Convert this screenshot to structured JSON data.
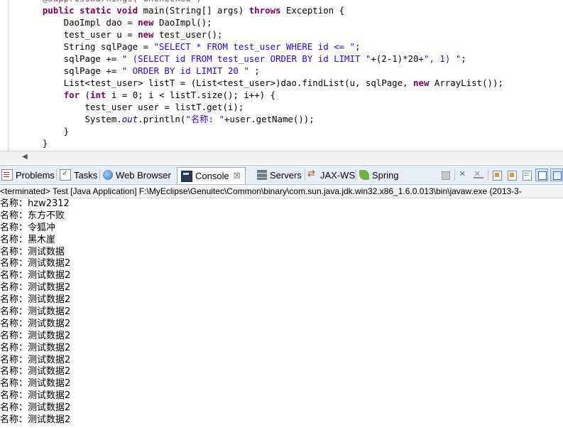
{
  "editor": {
    "lines": [
      [
        {
          "t": "    ",
          "c": ""
        },
        {
          "t": "@SuppressWarnings(\"unchecked\")",
          "c": "ann"
        }
      ],
      [
        {
          "t": "    ",
          "c": ""
        },
        {
          "t": "public static void",
          "c": "kw"
        },
        {
          "t": " main(String[] args) ",
          "c": ""
        },
        {
          "t": "throws",
          "c": "kw"
        },
        {
          "t": " Exception {",
          "c": ""
        }
      ],
      [
        {
          "t": "        DaoImpl dao = ",
          "c": ""
        },
        {
          "t": "new",
          "c": "kw"
        },
        {
          "t": " DaoImpl();",
          "c": ""
        }
      ],
      [
        {
          "t": "        test_user u = ",
          "c": ""
        },
        {
          "t": "new",
          "c": "kw"
        },
        {
          "t": " test_user();",
          "c": ""
        }
      ],
      [
        {
          "t": "        String sqlPage = ",
          "c": ""
        },
        {
          "t": "\"SELECT * FROM test_user WHERE id <= \"",
          "c": "str"
        },
        {
          "t": ";",
          "c": ""
        }
      ],
      [
        {
          "t": "        sqlPage += ",
          "c": ""
        },
        {
          "t": "\" (SELECT id FROM test_user ORDER BY id LIMIT \"",
          "c": "str"
        },
        {
          "t": "+(2-1)*20+",
          "c": ""
        },
        {
          "t": "\", 1) \"",
          "c": "str"
        },
        {
          "t": ";",
          "c": ""
        }
      ],
      [
        {
          "t": "        sqlPage += ",
          "c": ""
        },
        {
          "t": "\" ORDER BY id LIMIT 20 \"",
          "c": "str"
        },
        {
          "t": " ;",
          "c": ""
        }
      ],
      [
        {
          "t": "        List<test_user> listT = (List<test_user>)dao.findList(u, sqlPage, ",
          "c": ""
        },
        {
          "t": "new",
          "c": "kw"
        },
        {
          "t": " ArrayList());",
          "c": ""
        }
      ],
      [
        {
          "t": "        ",
          "c": ""
        },
        {
          "t": "for",
          "c": "kw"
        },
        {
          "t": " (",
          "c": ""
        },
        {
          "t": "int",
          "c": "kw"
        },
        {
          "t": " i = 0; i < listT.size(); i++) {",
          "c": ""
        }
      ],
      [
        {
          "t": "            test_user user = listT.get(i);",
          "c": ""
        }
      ],
      [
        {
          "t": "            System.",
          "c": ""
        },
        {
          "t": "out",
          "c": "it"
        },
        {
          "t": ".println(",
          "c": ""
        },
        {
          "t": "\"名称: \"",
          "c": "str"
        },
        {
          "t": "+user.getName());",
          "c": ""
        }
      ],
      [
        {
          "t": "        }",
          "c": ""
        }
      ],
      [
        {
          "t": "    }",
          "c": ""
        }
      ]
    ]
  },
  "editor_scroll": {
    "left_arrow": "◀"
  },
  "tabs": [
    {
      "label": "Problems",
      "icon": "problems-icon"
    },
    {
      "label": "Tasks",
      "icon": "tasks-icon"
    },
    {
      "label": "Web Browser",
      "icon": "web-browser-icon"
    },
    {
      "label": "Console",
      "icon": "console-icon",
      "close": "☒"
    },
    {
      "label": "Servers",
      "icon": "servers-icon"
    },
    {
      "label": "JAX-WS",
      "icon": "jax-ws-icon"
    },
    {
      "label": "Spring",
      "icon": "spring-icon"
    }
  ],
  "toolbar_icons": [
    "terminate-icon",
    "remove-launch-icon",
    "remove-all-terminated-icon",
    "clear-console-icon",
    "scroll-lock-icon",
    "word-wrap-icon",
    "pin-console-icon",
    "display-selected-console-icon"
  ],
  "console": {
    "header": "<terminated> Test [Java Application] F:\\MyEclipse\\Genuitec\\Common\\binary\\com.sun.java.jdk.win32.x86_1.6.0.013\\bin\\javaw.exe (2013-3-",
    "lines": [
      "名称：hzw2312",
      "名称：东方不败",
      "名称：令狐冲",
      "名称：黑木崖",
      "名称：测试数据",
      "名称：测试数据2",
      "名称：测试数据2",
      "名称：测试数据2",
      "名称：测试数据2",
      "名称：测试数据2",
      "名称：测试数据2",
      "名称：测试数据2",
      "名称：测试数据2",
      "名称：测试数据2",
      "名称：测试数据2",
      "名称：测试数据2",
      "名称：测试数据2",
      "名称：测试数据2",
      "名称：测试数据2"
    ]
  }
}
